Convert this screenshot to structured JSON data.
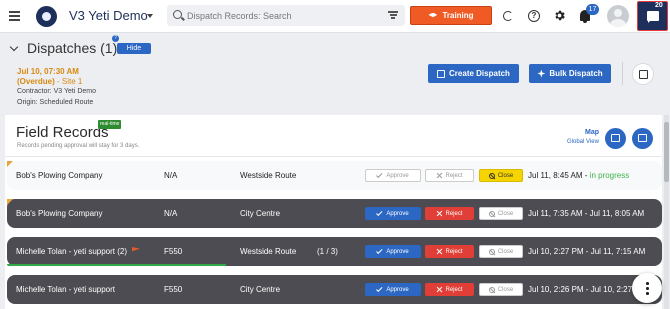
{
  "topbar": {
    "app_title": "V3 Yeti Demo",
    "search_placeholder": "Dispatch Records: Search",
    "training_label": "Training",
    "notifications_count": "17",
    "chat_count": "20"
  },
  "dispatches": {
    "title": "Dispatches (1)",
    "hide_label": "Hide",
    "item": {
      "time": "Jul 10, 07:30 AM",
      "overdue": "(Overdue)",
      "site": " - Site 1",
      "contractor": "Contractor: V3 Yeti Demo",
      "origin": "Origin: Scheduled Route"
    },
    "create_label": "Create Dispatch",
    "bulk_label": "Bulk Dispatch"
  },
  "field_records": {
    "title": "Field Records",
    "realtime_badge": "real-time",
    "pending_note": "Records pending approval will stay for 3 days.",
    "map_label": "Map",
    "global_view_label": "Global View",
    "action_labels": {
      "approve": "Approve",
      "reject": "Reject",
      "close": "Close"
    },
    "rows": [
      {
        "name": "Bob's Plowing Company",
        "vehicle": "N/A",
        "route": "Westside Route",
        "progress": "",
        "time": "Jul 11, 8:45 AM - ",
        "status": "in progress"
      },
      {
        "name": "Bob's Plowing Company",
        "vehicle": "N/A",
        "route": "City Centre",
        "progress": "",
        "time": "Jul 11, 7:35 AM - Jul 11, 8:05 AM",
        "status": ""
      },
      {
        "name": "Michelle Tolan - yeti support (2)",
        "vehicle": "F550",
        "route": "Westside Route",
        "progress": "(1 / 3)",
        "time": "Jul 10, 2:27 PM - Jul 11, 7:15 AM",
        "status": ""
      },
      {
        "name": "Michelle Tolan - yeti support",
        "vehicle": "F550",
        "route": "City Centre",
        "progress": "",
        "time": "Jul 10, 2:26 PM - Jul 10, 2:27 PM",
        "status": ""
      }
    ]
  },
  "colors": {
    "brand_navy": "#1d2f5a",
    "primary_blue": "#2b67c3",
    "training_orange": "#f05a24",
    "overdue_orange": "#d98a10",
    "reject_red": "#e03e36",
    "close_yellow": "#f5d400",
    "in_progress_green": "#3cb54a"
  },
  "icons": [
    "menu-icon",
    "logo-icon",
    "search-icon",
    "filter-icon",
    "graduation-cap-icon",
    "refresh-icon",
    "help-icon",
    "gear-icon",
    "bell-icon",
    "avatar",
    "chat-icon",
    "chevron-down-icon",
    "info-icon",
    "plus-square-icon",
    "bulk-icon",
    "calendar-icon",
    "map-icon",
    "open-external-icon",
    "check-icon",
    "x-icon",
    "no-entry-icon",
    "flag-icon",
    "more-vertical-icon"
  ]
}
